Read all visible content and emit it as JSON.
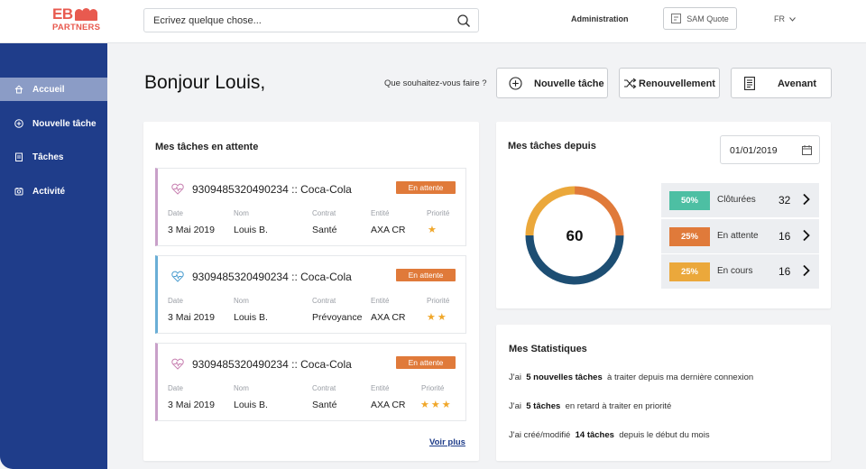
{
  "header": {
    "logo_top": "EB",
    "logo_bottom": "PARTNERS",
    "search_placeholder": "Ecrivez quelque chose...",
    "admin_label": "Administration",
    "sam_label": "SAM Quote",
    "lang_label": "FR"
  },
  "sidebar": {
    "items": [
      {
        "label": "Accueil",
        "icon": "home-icon"
      },
      {
        "label": "Nouvelle tâche",
        "icon": "plus-circle-icon"
      },
      {
        "label": "Tâches",
        "icon": "clipboard-icon"
      },
      {
        "label": "Activité",
        "icon": "activity-icon"
      }
    ]
  },
  "main": {
    "greeting": "Bonjour Louis,",
    "ask": "Que souhaitez-vous faire ?",
    "actions": {
      "new_task": "Nouvelle tâche",
      "renewal": "Renouvellement",
      "amendment": "Avenant"
    }
  },
  "pending": {
    "title": "Mes tâches en attente",
    "field_labels": {
      "date": "Date",
      "nom": "Nom",
      "contrat": "Contrat",
      "entite": "Entité",
      "priorite": "Priorité"
    },
    "tasks": [
      {
        "id": "9309485320490234 :: Coca-Cola",
        "status": "En attente",
        "date": "3 Mai 2019",
        "nom": "Louis B.",
        "contrat": "Santé",
        "entite": "AXA CR",
        "stars": "★",
        "priority": 1,
        "accent": "#c9a0c9"
      },
      {
        "id": "9309485320490234 :: Coca-Cola",
        "status": "En attente",
        "date": "3 Mai 2019",
        "nom": "Louis B.",
        "contrat": "Prévoyance",
        "entite": "AXA CR",
        "stars": "★★",
        "priority": 2,
        "accent": "#6aaed6"
      },
      {
        "id": "9309485320490234 :: Coca-Cola",
        "status": "En attente",
        "date": "3 Mai 2019",
        "nom": "Louis B.",
        "contrat": "Santé",
        "entite": "AXA CR",
        "stars": "★★★",
        "priority": 3,
        "accent": "#c9a0c9"
      }
    ],
    "see_more": "Voir plus"
  },
  "since": {
    "title": "Mes tâches depuis",
    "date": "01/01/2019",
    "total": "60",
    "rows": [
      {
        "pct": "50%",
        "label": "Clôturées",
        "count": "32",
        "color": "#4dbfa3",
        "fraction": 0.5
      },
      {
        "pct": "25%",
        "label": "En attente",
        "count": "16",
        "color": "#e07a3a",
        "fraction": 0.25
      },
      {
        "pct": "25%",
        "label": "En cours",
        "count": "16",
        "color": "#eba83b",
        "fraction": 0.25
      }
    ],
    "donut_colors": {
      "closed": "#1d4e73",
      "pending": "#e07a3a",
      "ongoing": "#eba83b"
    }
  },
  "stats": {
    "title": "Mes Statistiques",
    "lines": [
      {
        "pre": "J'ai",
        "bold": "5 nouvelles tâches",
        "post": "à traiter depuis ma dernière connexion"
      },
      {
        "pre": "J'ai",
        "bold": "5 tâches",
        "post": "en retard à traiter en priorité"
      },
      {
        "pre": "J'ai créé/modifié",
        "bold": "14 tâches",
        "post": "depuis le début du mois"
      }
    ]
  },
  "colors": {
    "sidebar": "#1f3d8a",
    "sidebar_active": "#8b9cc6",
    "brand": "#e85a4f",
    "status_badge": "#e07a3a",
    "star": "#f0a72a"
  }
}
